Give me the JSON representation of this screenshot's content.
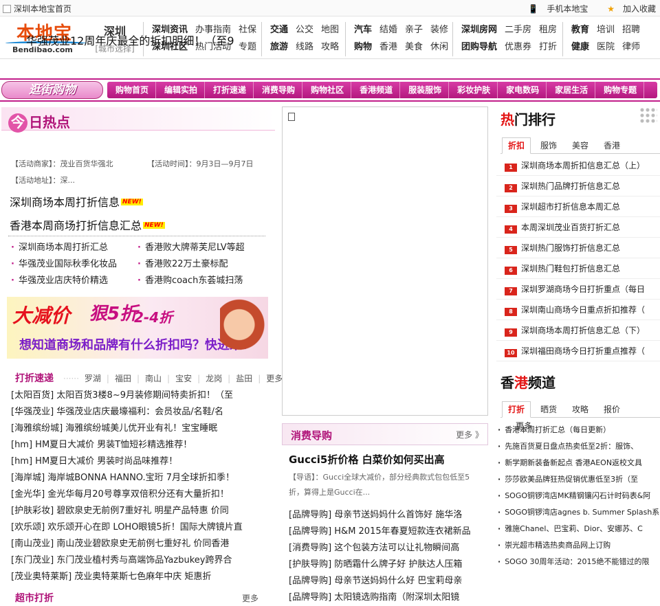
{
  "topbar": {
    "home": "深圳本地宝首页",
    "mobile": "手机本地宝",
    "fav": "加入收藏"
  },
  "header": {
    "logo_cn": "本地宝",
    "logo_url": "Bendibao.com",
    "city": "深圳",
    "city_select": "[城市选择]",
    "groups": [
      {
        "r1": [
          [
            "深圳资讯",
            true
          ],
          [
            "办事指南",
            false
          ],
          [
            "社保",
            false
          ]
        ],
        "r2": [
          [
            "深圳社区",
            true
          ],
          [
            "热门活动",
            false
          ],
          [
            "专题",
            false
          ]
        ]
      },
      {
        "r1": [
          [
            "交通",
            true
          ],
          [
            "公交",
            false
          ],
          [
            "地图",
            false
          ]
        ],
        "r2": [
          [
            "旅游",
            true
          ],
          [
            "线路",
            false
          ],
          [
            "攻略",
            false
          ]
        ]
      },
      {
        "r1": [
          [
            "汽车",
            true
          ],
          [
            "结婚",
            false
          ],
          [
            "亲子",
            false
          ],
          [
            "装修",
            false
          ]
        ],
        "r2": [
          [
            "购物",
            true
          ],
          [
            "香港",
            false
          ],
          [
            "美食",
            false
          ],
          [
            "休闲",
            false
          ]
        ]
      },
      {
        "r1": [
          [
            "深圳房网",
            true
          ],
          [
            "二手房",
            false
          ],
          [
            "租房",
            false
          ]
        ],
        "r2": [
          [
            "团购导航",
            true
          ],
          [
            "优惠券",
            false
          ],
          [
            "打折",
            false
          ]
        ]
      },
      {
        "r1": [
          [
            "教育",
            true
          ],
          [
            "培训",
            false
          ],
          [
            "招聘",
            false
          ]
        ],
        "r2": [
          [
            "健康",
            true
          ],
          [
            "医院",
            false
          ],
          [
            "律师",
            false
          ]
        ]
      }
    ]
  },
  "shopbar": {
    "brand": "逛街购物",
    "menu": [
      "购物首页",
      "编辑实拍",
      "打折速递",
      "消费导购",
      "购物社区",
      "香港频道",
      "服装服饰",
      "彩妆护肤",
      "家电数码",
      "家居生活",
      "购物专题"
    ]
  },
  "hot": {
    "title_char": "今",
    "title_rest": "日热点",
    "headline": "华强茂业12周年庆最全的折扣明细！（至9",
    "merchant": "【活动商家】：茂业百货华强北",
    "time": "【活动时间】：9月3日—9月7日",
    "address": "【活动地址】：深...",
    "big1": "深圳商场本周打折信息",
    "big2": "香港本周商场打折信息汇总",
    "new_tag": "NEW!",
    "list_left": [
      "深圳商场本周打折汇总",
      "华强茂业国际秋季化妆品",
      "华强茂业店庆特价精选"
    ],
    "list_right": [
      "香港败大牌蒂芙尼LV等超",
      "香港败22万土豪标配",
      "香港购coach东荟城扫荡"
    ]
  },
  "banner": {
    "big": "大减价",
    "fold": "狠5折",
    "num": "2-4折",
    "slogan": "想知道商场和品牌有什么折扣吗？快进来!"
  },
  "discount": {
    "title": "打折速递",
    "areas": [
      "罗湖",
      "福田",
      "南山",
      "宝安",
      "龙岗",
      "盐田",
      "更多"
    ],
    "items": [
      "[太阳百货] 太阳百货3楼8~9月装修期间特卖折扣！（至",
      "[华强茂业] 华强茂业店庆最壕福利：会员妆品/名鞋/名",
      "[海雅缤纷城] 海雅缤纷城美儿优开业有礼！宝宝睡眠",
      "[hm] HM夏日大减价 男装T恤短衫精选推荐！",
      "[hm] HM夏日大减价 男装时尚品味推荐！",
      "[海岸城] 海岸城BONNA HANNO.宝珩 7月全球折扣季！",
      "[金光华] 金光华每月20号尊享双倍积分还有大量折扣！",
      "[护肤彩妆] 碧欧泉史无前例7重好礼 明星产品特惠 价同",
      "[欢乐颂] 欢乐颂开心在即 LOHO眼镜5折！国际大牌镜片直",
      "[南山茂业] 南山茂业碧欧泉史无前例七重好礼 价同香港",
      "[东门茂业] 东门茂业植村秀与高端饰品Yazbukey跨界合",
      "[茂业奥特莱斯] 茂业奥特莱斯七色麻年中庆 矩惠折"
    ],
    "next_title": "超市打折",
    "next_more": "更多"
  },
  "guide": {
    "title": "消费导购",
    "more": "更多 》",
    "headline": "Gucci5折价格 白菜价如何买出高",
    "desc": "【导语】：Gucci全球大减价，部分经典款式包包低至5折，算得上是Gucci在...",
    "items": [
      "[品牌导购] 母亲节送妈妈什么首饰好 施华洛",
      "[品牌导购] H&M 2015年春夏短款连衣裙新品",
      "[消费导购] 这个包装方法可以让礼物瞬间高",
      "[护肤导购] 防晒霜什么牌子好 护肤达人压箱",
      "[品牌导购] 母亲节送妈妈什么好 巴宝莉母亲",
      "[品牌导购] 太阳镜选购指南（附深圳太阳镜"
    ]
  },
  "ranking": {
    "title_red": "热",
    "title_rest": "门排行",
    "tabs": [
      "折扣",
      "服饰",
      "美容",
      "香港"
    ],
    "items": [
      "深圳商场本周折扣信息汇总（上）",
      "深圳热门品牌打折信息汇总",
      "深圳超市打折信息本周汇总",
      "本周深圳茂业百货打折汇总",
      "深圳热门服饰打折信息汇总",
      "深圳热门鞋包打折信息汇总",
      "深圳罗湖商场今日打折重点（每日",
      "深圳南山商场今日重点折扣推荐（",
      "深圳商场本周打折信息汇总（下）",
      "深圳福田商场今日打折重点推荐（"
    ]
  },
  "hk": {
    "title_a": "香",
    "title_b": "港",
    "title_c": "频道",
    "tabs": [
      "打折",
      "晒货",
      "攻略",
      "报价",
      "更多"
    ],
    "items": [
      "香港本周打折汇总（每日更新）",
      "先施百货夏日盘点热卖低至2折：服饰、",
      "新学期新装备新起点 香港AEON返校文具",
      "莎莎欧美品牌狂热促销优惠低至3折（至",
      "SOGO铜锣湾店MK精钢镶闪石计时码表&阿",
      "SOGO铜锣湾店agnes b. Summer Splash系",
      "雅施Chanel、巴宝莉、Dior、安娜苏、C",
      "崇光超市精选热卖商品网上订购",
      "SOGO 30周年活动：2015绝不能错过的限"
    ]
  }
}
